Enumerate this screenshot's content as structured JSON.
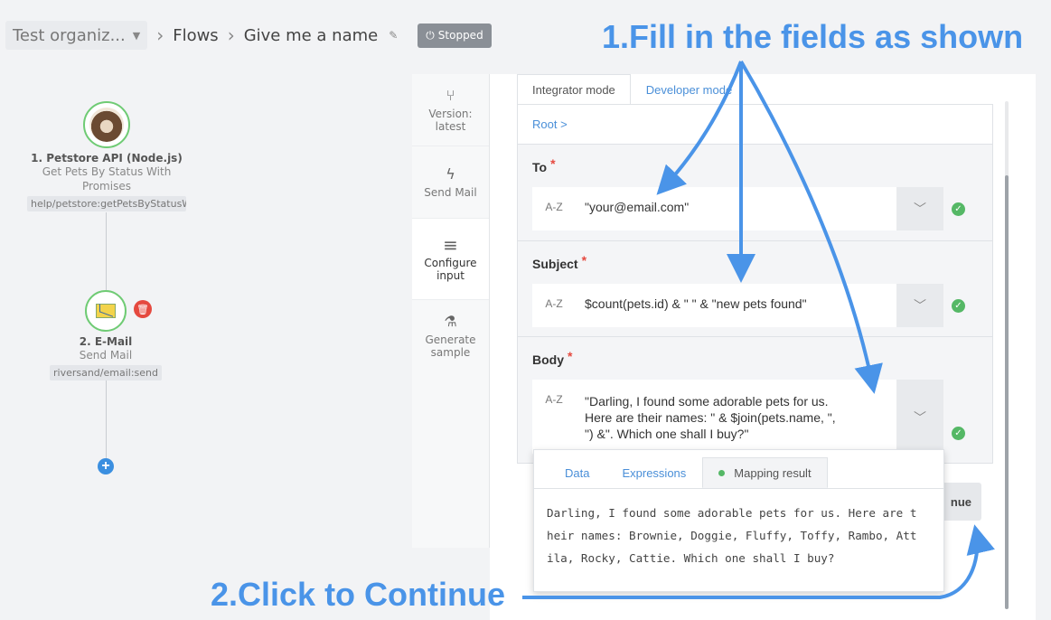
{
  "breadcrumb": {
    "org": "Test organiz...",
    "flows": "Flows",
    "flow_name": "Give me a name",
    "status": "Stopped"
  },
  "flow": {
    "step1": {
      "title": "1. Petstore API (Node.js)",
      "subtitle_line1": "Get Pets By Status With",
      "subtitle_line2": "Promises",
      "tag": "help/petstore:getPetsByStatusW"
    },
    "step2": {
      "title": "2. E-Mail",
      "subtitle": "Send Mail",
      "tag": "riversand/email:send"
    }
  },
  "rail": [
    {
      "label_line1": "Version:",
      "label_line2": "latest",
      "icon": "branch-icon"
    },
    {
      "label_line1": "Send Mail",
      "label_line2": "",
      "icon": "bolt-icon"
    },
    {
      "label_line1": "Configure",
      "label_line2": "input",
      "icon": "menu-icon"
    },
    {
      "label_line1": "Generate",
      "label_line2": "sample",
      "icon": "flask-icon"
    }
  ],
  "tabs": {
    "integrator": "Integrator mode",
    "developer": "Developer mode"
  },
  "form": {
    "root": "Root >",
    "fields": [
      {
        "label": "To",
        "type": "A-Z",
        "value": "\"your@email.com\""
      },
      {
        "label": "Subject",
        "type": "A-Z",
        "value": "$count(pets.id) & \" \" & \"new pets found\""
      },
      {
        "label": "Body",
        "type": "A-Z",
        "value_line1": "\"Darling, I found some adorable pets for us.",
        "value_line2": "Here are their names: \" & $join(pets.name, \",",
        "value_line3": "\") &\". Which one shall I buy?\""
      }
    ],
    "required_mark": "*"
  },
  "popup": {
    "tabs": [
      "Data",
      "Expressions",
      "Mapping result"
    ],
    "result_line1": "Darling, I found some adorable pets for us. Here are t",
    "result_line2": "heir names: Brownie, Doggie, Fluffy, Toffy, Rambo, Att",
    "result_line3": "ila, Rocky, Cattie. Which one shall I buy?"
  },
  "continue_label": "nue",
  "annotations": {
    "step1": "1.Fill in the fields as shown",
    "step2": "2.Click to Continue"
  },
  "colors": {
    "accent": "#4a94e8",
    "success": "#55b866",
    "danger": "#e5493f"
  }
}
